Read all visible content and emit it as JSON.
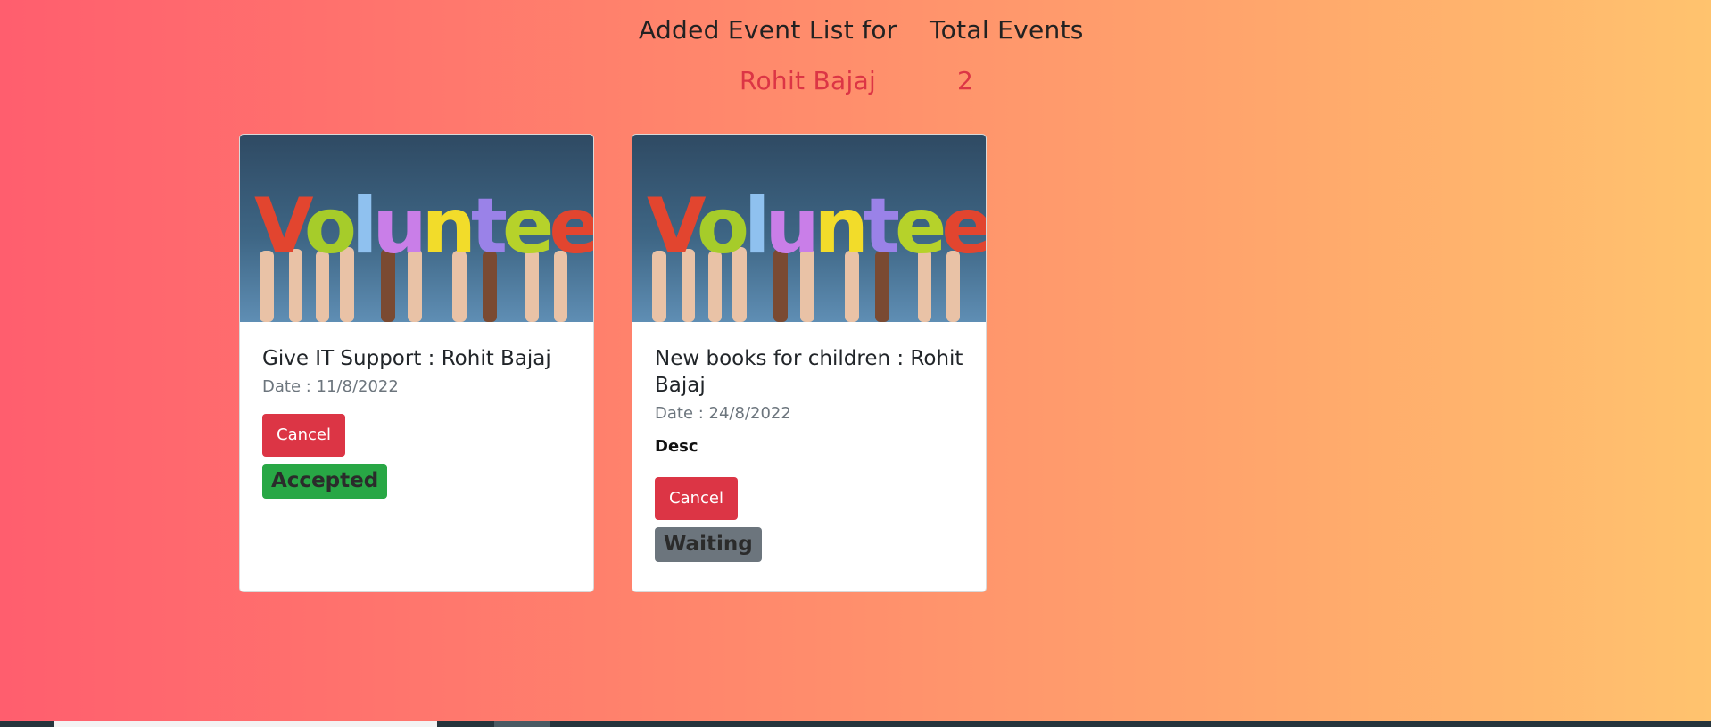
{
  "header": {
    "title": "Added Event List for",
    "user_name": "Rohit Bajaj",
    "total_label": "Total Events",
    "total_count": "2"
  },
  "cards": [
    {
      "image_word": "Volunteer",
      "title": "Give IT Support : Rohit Bajaj",
      "date": "Date : 11/8/2022",
      "desc": "",
      "cancel_label": "Cancel",
      "status": "Accepted",
      "status_color": "#28a745"
    },
    {
      "image_word": "Volunteer",
      "title": "New books for children : Rohit Bajaj",
      "date": "Date : 24/8/2022",
      "desc": "Desc",
      "cancel_label": "Cancel",
      "status": "Waiting",
      "status_color": "#6c757d"
    }
  ],
  "colors": {
    "accent_red": "#dc3545",
    "gradient_start": "#ff5e6e",
    "gradient_end": "#ffc36e"
  }
}
